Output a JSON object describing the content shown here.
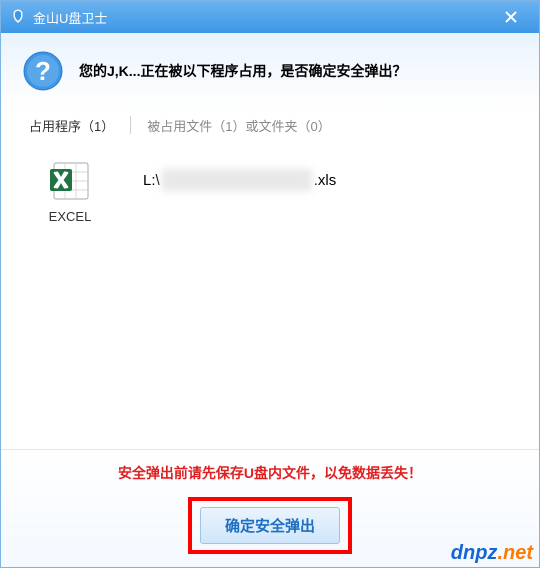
{
  "titlebar": {
    "title": "金山U盘卫士"
  },
  "header": {
    "message": "您的J,K...正在被以下程序占用，是否确定安全弹出？"
  },
  "tabs": {
    "programs": "占用程序（1）",
    "files": "被占用文件（1）或文件夹（0）"
  },
  "program": {
    "label": "EXCEL"
  },
  "file": {
    "prefix": "L:\\",
    "suffix": ".xls"
  },
  "footer": {
    "warning": "安全弹出前请先保存U盘内文件，以免数据丢失！",
    "confirm": "确定安全弹出"
  },
  "watermark": {
    "line1": "dnpz",
    "line2": ".net"
  }
}
